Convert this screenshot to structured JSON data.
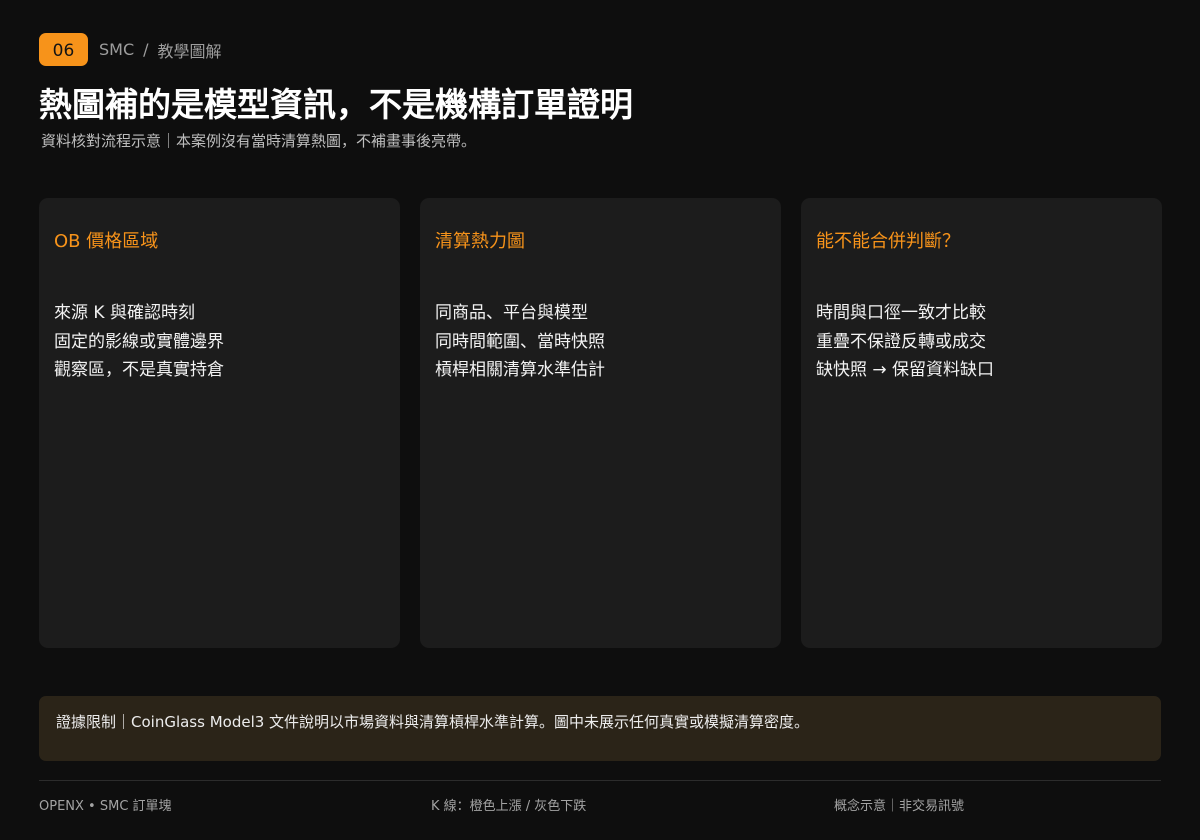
{
  "header": {
    "badge": "06",
    "crumb_section": "SMC",
    "crumb_separator": "/",
    "crumb_page": "教學圖解"
  },
  "title": "熱圖補的是模型資訊，不是機構訂單證明",
  "subtitle": "資料核對流程示意｜本案例沒有當時清算熱圖，不補畫事後亮帶。",
  "cards": [
    {
      "title": "OB 價格區域",
      "items": [
        "來源 K 與確認時刻",
        "固定的影線或實體邊界",
        "觀察區，不是真實持倉"
      ]
    },
    {
      "title": "清算熱力圖",
      "items": [
        "同商品、平台與模型",
        "同時間範圍、當時快照",
        "槓桿相關清算水準估計"
      ]
    },
    {
      "title": "能不能合併判斷？",
      "items": [
        "時間與口徑一致才比較",
        "重疊不保證反轉或成交",
        "缺快照 → 保留資料缺口"
      ]
    }
  ],
  "evidence": "證據限制｜CoinGlass Model3 文件說明以市場資料與清算槓桿水準計算。圖中未展示任何真實或模擬清算密度。",
  "footer": {
    "left": "OPENX • SMC 訂單塊",
    "center": "K 線：橙色上漲 / 灰色下跌",
    "right": "概念示意｜非交易訊號"
  },
  "colors": {
    "accent": "#f7931a",
    "background": "#0e0e0e",
    "card": "#1c1c1c",
    "evidence_bg": "#2b2418"
  }
}
